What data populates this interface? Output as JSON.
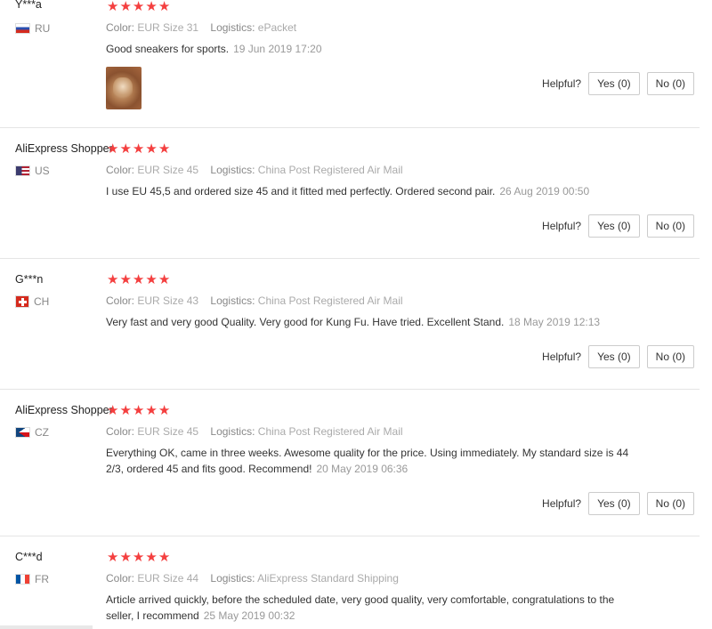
{
  "reviews": [
    {
      "name": "Y***a",
      "country": "RU",
      "color_label": "Color:",
      "color_value": "EUR Size 31",
      "logistics_label": "Logistics:",
      "logistics_value": "ePacket",
      "text": "Good sneakers for sports.",
      "date": "19 Jun 2019 17:20",
      "has_photo": true,
      "helpful_label": "Helpful?",
      "yes_label": "Yes (0)",
      "no_label": "No (0)",
      "rating": 5
    },
    {
      "name": "AliExpress Shopper",
      "country": "US",
      "color_label": "Color:",
      "color_value": "EUR Size 45",
      "logistics_label": "Logistics:",
      "logistics_value": "China Post Registered Air Mail",
      "text": "I use EU 45,5 and ordered size 45 and it fitted med perfectly. Ordered second pair.",
      "date": "26 Aug 2019 00:50",
      "helpful_label": "Helpful?",
      "yes_label": "Yes (0)",
      "no_label": "No (0)",
      "rating": 5
    },
    {
      "name": "G***n",
      "country": "CH",
      "color_label": "Color:",
      "color_value": "EUR Size 43",
      "logistics_label": "Logistics:",
      "logistics_value": "China Post Registered Air Mail",
      "text": "Very fast and very good Quality. Very good for Kung Fu. Have tried. Excellent Stand.",
      "date": "18 May 2019 12:13",
      "helpful_label": "Helpful?",
      "yes_label": "Yes (0)",
      "no_label": "No (0)",
      "rating": 5
    },
    {
      "name": "AliExpress Shopper",
      "country": "CZ",
      "color_label": "Color:",
      "color_value": "EUR Size 45",
      "logistics_label": "Logistics:",
      "logistics_value": "China Post Registered Air Mail",
      "text": "Everything OK, came in three weeks. Awesome quality for the price. Using immediately. My standard size is 44 2/3, ordered 45 and fits good. Recommend!",
      "date": "20 May 2019 06:36",
      "helpful_label": "Helpful?",
      "yes_label": "Yes (0)",
      "no_label": "No (0)",
      "rating": 5
    },
    {
      "name": "C***d",
      "country": "FR",
      "color_label": "Color:",
      "color_value": "EUR Size 44",
      "logistics_label": "Logistics:",
      "logistics_value": "AliExpress Standard Shipping",
      "text": "Article arrived quickly, before the scheduled date, very good quality, very comfortable, congratulations to the seller, I recommend",
      "date": "25 May 2019 00:32",
      "rating": 5
    }
  ],
  "colors": {
    "star": "#f43f3f",
    "muted": "#888888",
    "border": "#e5e5e5"
  }
}
